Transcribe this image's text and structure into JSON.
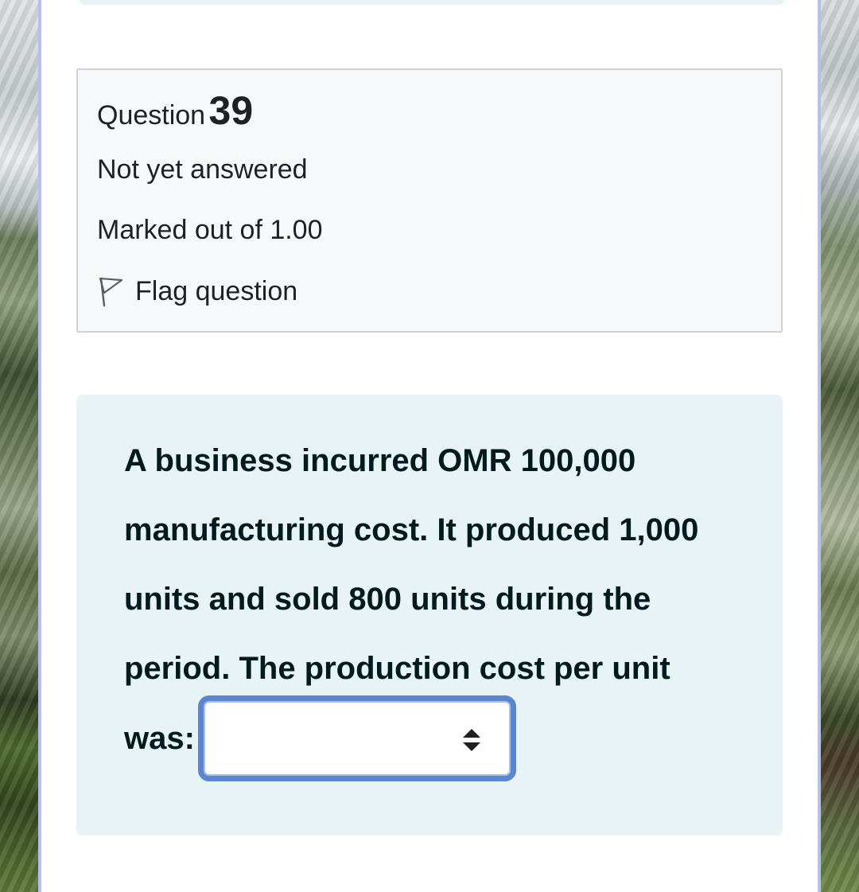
{
  "question": {
    "label": "Question",
    "number": "39",
    "state": "Not yet answered",
    "grade": "Marked out of 1.00",
    "flag_label": "Flag question",
    "flag_icon": "flag-outline-icon"
  },
  "content": {
    "text": "A business incurred OMR 100,000 manufacturing cost. It produced 1,000 units and sold 800 units during the period. The production cost per unit",
    "answer_label": "was:",
    "answer_value": "",
    "answer_icon": "select-caret-icon"
  },
  "colors": {
    "info_bg": "#f6f8fa",
    "content_bg": "#e7f3f5",
    "select_focus_border": "#5b85cf",
    "text": "#1d2125"
  }
}
